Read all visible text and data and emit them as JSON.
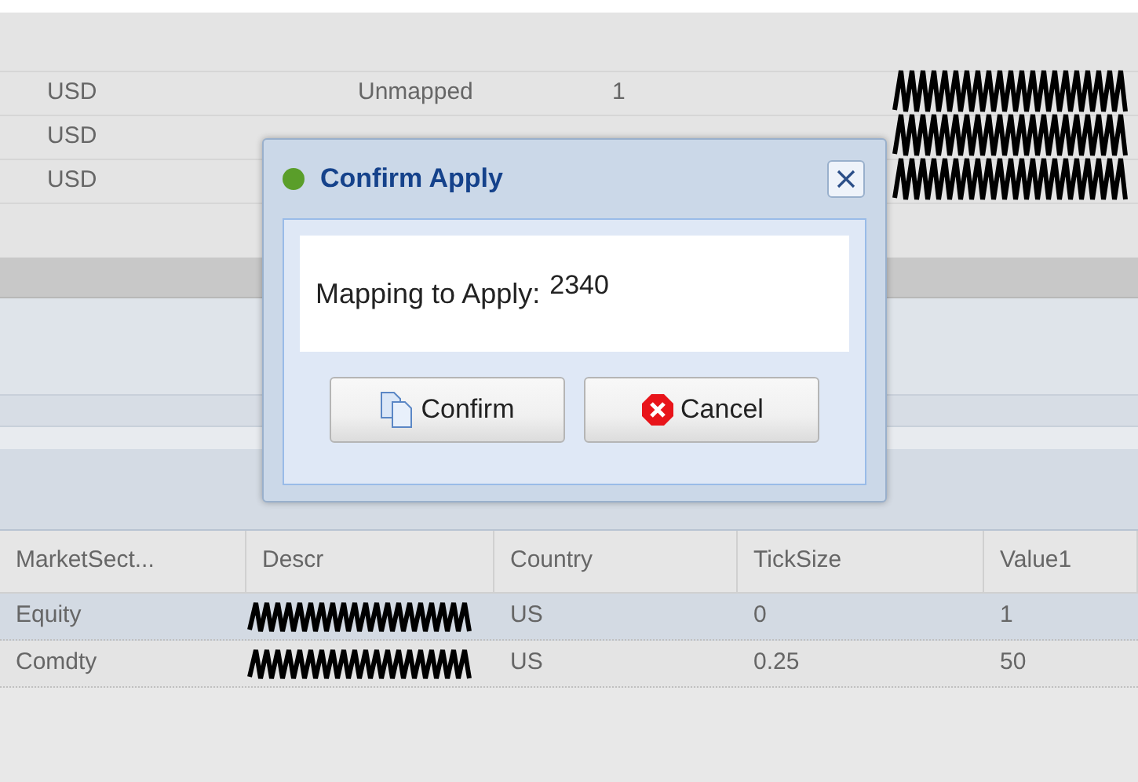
{
  "top_grid": {
    "rows": [
      {
        "currency": "USD",
        "status": "Unmapped",
        "count": "1",
        "redacted": true
      },
      {
        "currency": "USD",
        "redacted": true
      },
      {
        "currency": "USD",
        "redacted": true
      }
    ]
  },
  "bottom_grid": {
    "columns": [
      "MarketSect...",
      "Descr",
      "Country",
      "TickSize",
      "Value1"
    ],
    "rows": [
      {
        "selected": true,
        "cells": [
          "Equity",
          null,
          "US",
          "0",
          "1"
        ]
      },
      {
        "selected": false,
        "cells": [
          "Comdty",
          null,
          "US",
          "0.25",
          "50"
        ]
      }
    ]
  },
  "dialog": {
    "title": "Confirm Apply",
    "label": "Mapping to Apply:",
    "value": "2340",
    "buttons": [
      {
        "kind": "confirm",
        "label": "Confirm"
      },
      {
        "kind": "cancel",
        "label": "Cancel"
      }
    ]
  }
}
